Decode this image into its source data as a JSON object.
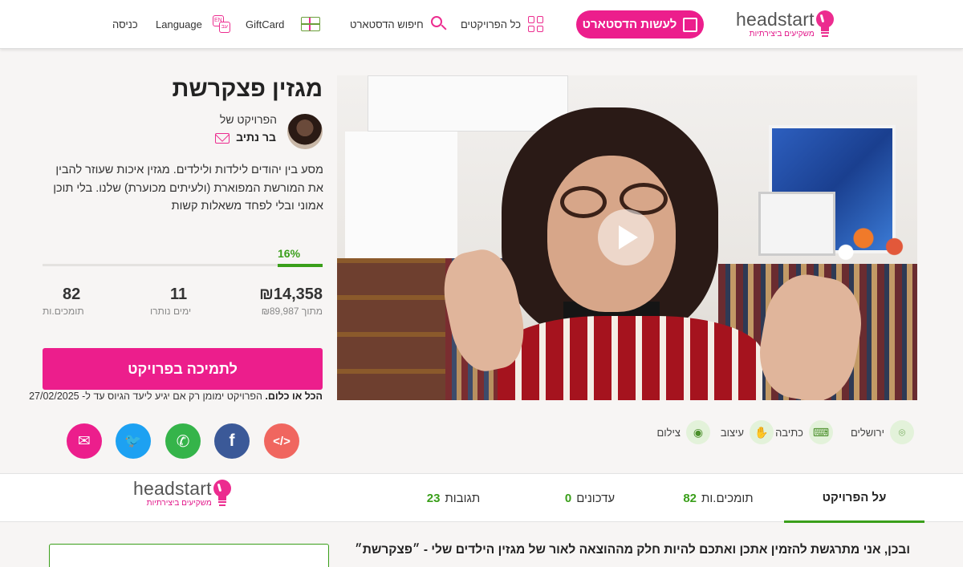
{
  "header": {
    "logo_word": "headstart",
    "logo_tagline": "משקיעים ביצירתיות",
    "cta_label": "לעשות הדסטארט",
    "nav": {
      "all_projects": "כל הפרויקטים",
      "search": "חיפוש הדסטארט",
      "giftcard": "GiftCard",
      "language": "Language",
      "login": "כניסה"
    },
    "lang_icon_a": "EN",
    "lang_icon_b": "עב"
  },
  "project": {
    "title": "מגזין פצקרשת",
    "byline": "הפרויקט של",
    "author": "בר נתיב",
    "description": "מסע בין יהודים לילדות ולילדים. מגזין איכות שעוזר להבין את המורשת המפוארת (ולעיתים מכוערת) שלנו. בלי תוכן אמוני ובלי לפחד משאלות קשות",
    "percent_label": "16%",
    "progress_fraction": 0.16,
    "raised": "₪14,358",
    "goal": "מתוך ₪89,987",
    "days": "11",
    "days_label": "ימים נותרו",
    "backers": "82",
    "backers_label": "תומכים.ות",
    "back_button": "לתמיכה בפרויקט",
    "all_or_nothing_bold": "הכל או כלום.",
    "all_or_nothing_text": " הפרויקט ימומן רק אם יגיע ליעד הגיוס עד ל- 27/02/2025"
  },
  "share": {
    "embed_label": "</>",
    "facebook_label": "f",
    "whatsapp_label": "✆",
    "twitter_label": "🐦",
    "email_label": "✉",
    "colors": {
      "embed": "#f0665f",
      "facebook": "#3b5998",
      "whatsapp": "#35b44a",
      "twitter": "#1da1f2",
      "email": "#ec1e8c"
    }
  },
  "tags": {
    "location": "ירושלים",
    "writing": "כתיבה",
    "design": "עיצוב",
    "photo": "צילום"
  },
  "tabs": {
    "about": "על הפרויקט",
    "backers": "תומכים.ות",
    "backers_count": "82",
    "updates": "עדכונים",
    "updates_count": "0",
    "comments": "תגובות",
    "comments_count": "23"
  },
  "content": {
    "intro": "ובכן, אני מתרגשת להזמין אתכן ואתכם להיות חלק מההוצאה לאור של מגזין הילדים שלי - ״פצקרשת״"
  }
}
